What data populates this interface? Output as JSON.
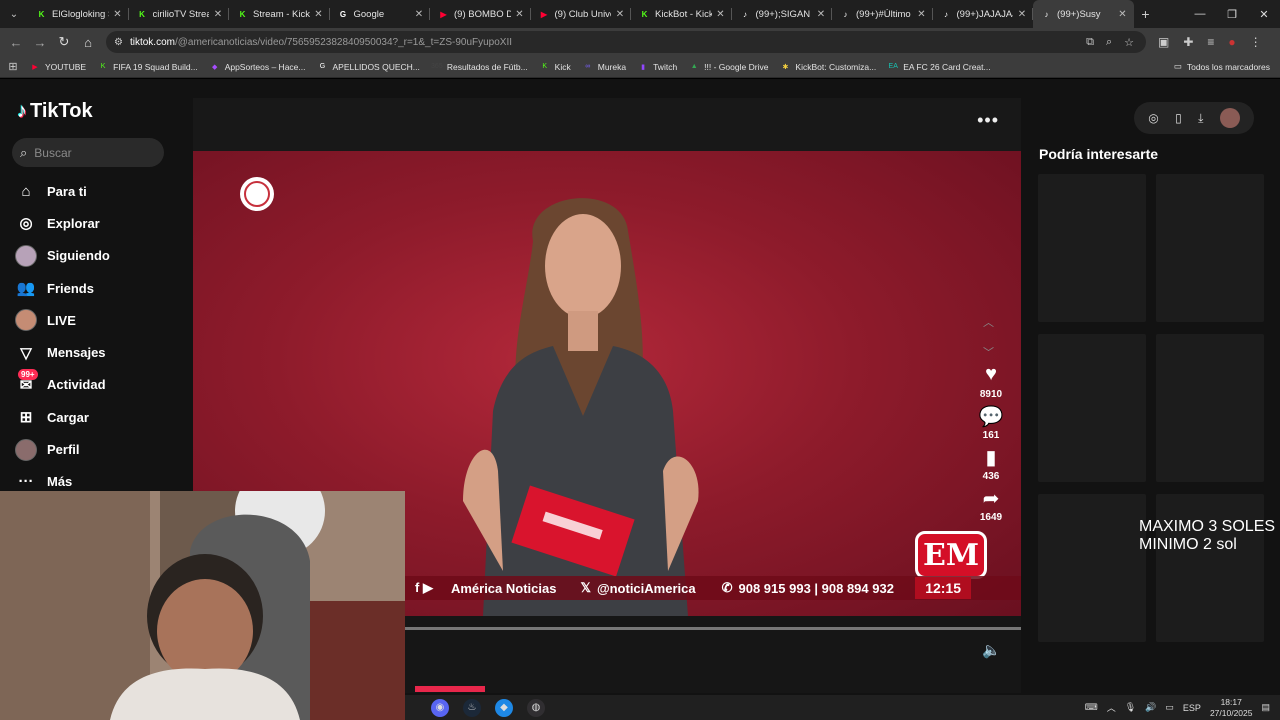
{
  "browser": {
    "tabs": [
      {
        "title": "ElGlogloking S",
        "favicon": "K",
        "color": "#53fc18",
        "active": false
      },
      {
        "title": "cirilioTV Stream",
        "favicon": "K",
        "color": "#53fc18",
        "active": false
      },
      {
        "title": "Stream - Kick",
        "favicon": "K",
        "color": "#53fc18",
        "active": false
      },
      {
        "title": "Google",
        "favicon": "G",
        "color": "#ffffff",
        "active": false
      },
      {
        "title": "(9) BOMBO De",
        "favicon": "▶",
        "color": "#ff0033",
        "active": false
      },
      {
        "title": "(9) Club Univer",
        "favicon": "▶",
        "color": "#ff0033",
        "active": false
      },
      {
        "title": "KickBot - Kick",
        "favicon": "K",
        "color": "#53fc18",
        "active": false
      },
      {
        "title": "(99+);SIGAN L",
        "favicon": "♪",
        "color": "#ffffff",
        "active": false
      },
      {
        "title": "(99+)#Último",
        "favicon": "♪",
        "color": "#ffffff",
        "active": false
      },
      {
        "title": "(99+)JAJAJAJ",
        "favicon": "♪",
        "color": "#ffffff",
        "active": false
      },
      {
        "title": "(99+)Susy",
        "favicon": "♪",
        "color": "#ffffff",
        "active": true
      }
    ],
    "url_host": "tiktok.com",
    "url_path": "/@americanoticias/video/7565952382840950034?_r=1&_t=ZS-90uFyupoXII",
    "bookmarks": [
      {
        "label": "YOUTUBE",
        "color": "#ff0033",
        "icon": "▶"
      },
      {
        "label": "FIFA 19 Squad Build...",
        "color": "#53fc18",
        "icon": "K"
      },
      {
        "label": "AppSorteos – Hace...",
        "color": "#a64dff",
        "icon": "◆"
      },
      {
        "label": "APELLIDOS QUECH...",
        "color": "#ffffff",
        "icon": "G"
      },
      {
        "label": "Resultados de Fútb...",
        "color": "#444444",
        "icon": "365"
      },
      {
        "label": "Kick",
        "color": "#53fc18",
        "icon": "K"
      },
      {
        "label": "Mureka",
        "color": "#7b61ff",
        "icon": "∞"
      },
      {
        "label": "Twitch",
        "color": "#9146ff",
        "icon": "▮"
      },
      {
        "label": "!!! - Google Drive",
        "color": "#34a853",
        "icon": "▲"
      },
      {
        "label": "KickBot: Customiza...",
        "color": "#f4d03f",
        "icon": "✱"
      },
      {
        "label": "EA FC 26 Card Creat...",
        "color": "#17c3b2",
        "icon": "EA"
      }
    ],
    "all_bookmarks": "Todos los marcadores"
  },
  "tiktok": {
    "logo": "TikTok",
    "search_placeholder": "Buscar",
    "nav": [
      {
        "label": "Para ti",
        "icon": "⌂"
      },
      {
        "label": "Explorar",
        "icon": "◎"
      },
      {
        "label": "Siguiendo",
        "icon": "avatar"
      },
      {
        "label": "Friends",
        "icon": "👥"
      },
      {
        "label": "LIVE",
        "icon": "avatar"
      },
      {
        "label": "Mensajes",
        "icon": "▽"
      },
      {
        "label": "Actividad",
        "icon": "✉"
      },
      {
        "label": "Cargar",
        "icon": "⊞"
      },
      {
        "label": "Perfil",
        "icon": "avatar"
      },
      {
        "label": "Más",
        "icon": "···"
      }
    ],
    "activity_badge": "99+",
    "video": {
      "social_bar": "América Noticias",
      "handle": "@noticiAmerica",
      "phone": "908 915 993  |  908 894 932",
      "clock": "12:15",
      "channel_logo": "EM"
    },
    "actions": {
      "likes": "8910",
      "comments": "161",
      "saves": "436",
      "shares": "1649"
    },
    "suggestions_title": "Podría interesarte",
    "overlay_text": "MAXIMO 3 SOLES\nMINIMO 2 sol"
  },
  "taskbar": {
    "language": "ESP",
    "time": "18:17",
    "date": "27/10/2025"
  }
}
